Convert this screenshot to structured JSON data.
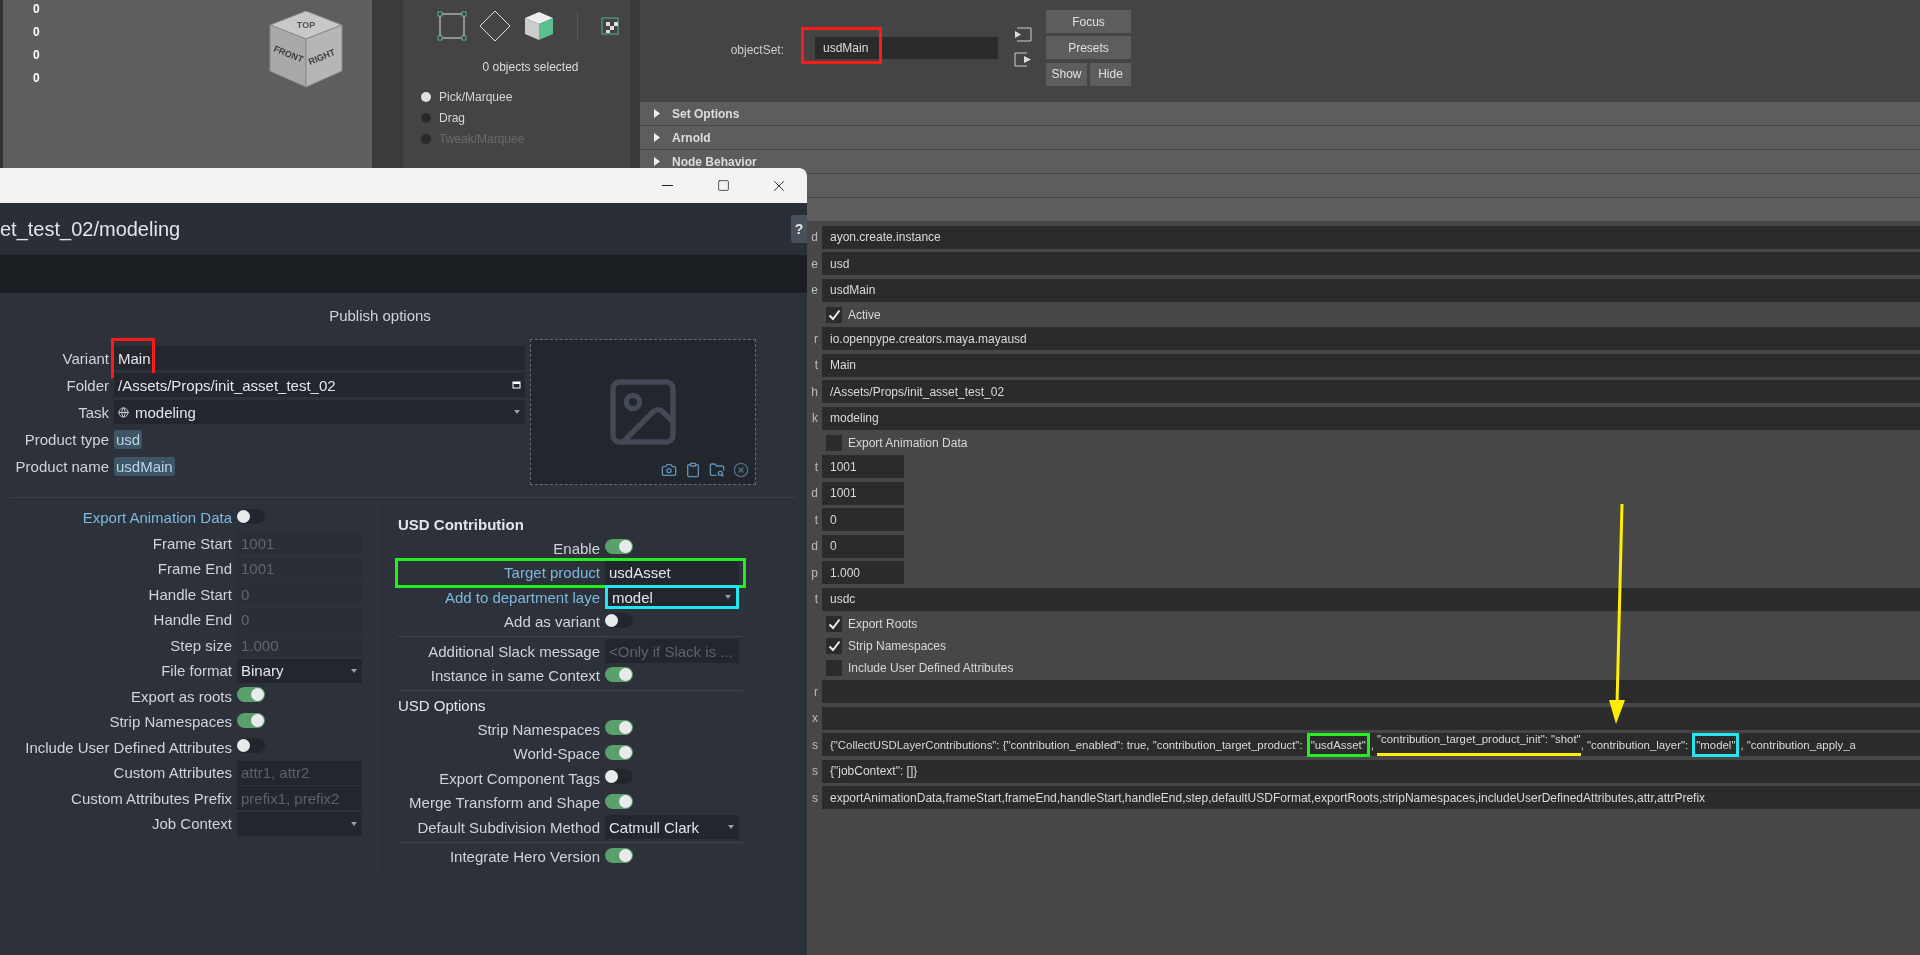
{
  "viewport": {
    "axis_values": [
      "0",
      "0",
      "0",
      "0"
    ],
    "view_cube": {
      "top": "TOP",
      "front": "FRONT",
      "right": "RIGHT"
    }
  },
  "tool_settings": {
    "selection_info": "0 objects selected",
    "modes": [
      {
        "label": "Pick/Marquee",
        "selected": true,
        "disabled": false
      },
      {
        "label": "Drag",
        "selected": false,
        "disabled": false
      },
      {
        "label": "Tweak/Marquee",
        "selected": false,
        "disabled": true
      }
    ]
  },
  "attribute_editor": {
    "object_set": {
      "label": "objectSet:",
      "value": "usdMain",
      "color": "#ff1a1a"
    },
    "buttons": [
      "Focus",
      "Presets",
      "Show",
      "Hide"
    ],
    "sections": [
      {
        "label": "Set Options"
      },
      {
        "label": "Arnold"
      },
      {
        "label": "Node Behavior"
      }
    ],
    "arrow": {
      "color": "#ffee00"
    },
    "rows": [
      {
        "kind": "text",
        "label_tail": "d",
        "value": "ayon.create.instance"
      },
      {
        "kind": "text",
        "label_tail": "e",
        "value": "usd"
      },
      {
        "kind": "text",
        "label_tail": "e",
        "value": "usdMain"
      },
      {
        "kind": "checkbox",
        "label": "Active",
        "checked": true
      },
      {
        "kind": "text",
        "label_tail": "r",
        "value": "io.openpype.creators.maya.mayausd"
      },
      {
        "kind": "text",
        "label_tail": "t",
        "value": "Main"
      },
      {
        "kind": "text",
        "label_tail": "h",
        "value": "/Assets/Props/init_asset_test_02"
      },
      {
        "kind": "text",
        "label_tail": "k",
        "value": "modeling"
      },
      {
        "kind": "checkbox",
        "label": "Export Animation Data",
        "checked": false
      },
      {
        "kind": "short",
        "label_tail": "t",
        "value": "1001"
      },
      {
        "kind": "short",
        "label_tail": "d",
        "value": "1001"
      },
      {
        "kind": "short",
        "label_tail": "t",
        "value": "0"
      },
      {
        "kind": "short",
        "label_tail": "d",
        "value": "0"
      },
      {
        "kind": "short",
        "label_tail": "p",
        "value": "1.000"
      },
      {
        "kind": "text",
        "label_tail": "t",
        "value": "usdc"
      },
      {
        "kind": "checkbox",
        "label": "Export Roots",
        "checked": true
      },
      {
        "kind": "checkbox",
        "label": "Strip Namespaces",
        "checked": true
      },
      {
        "kind": "checkbox",
        "label": "Include User Defined Attributes",
        "checked": false
      },
      {
        "kind": "text",
        "label_tail": "r"
      },
      {
        "kind": "text",
        "label_tail": "x"
      },
      {
        "kind": "segments",
        "label_tail": "s",
        "segments": [
          {
            "text": "{\"CollectUSDLayerContributions\": {\"contribution_enabled\": true, \"contribution_target_product\": "
          },
          {
            "text": "\"usdAsset\"",
            "kind": "box",
            "color": "#22ee22"
          },
          {
            "text": ", "
          },
          {
            "text": "\"contribution_target_product_init\": \"shot\"",
            "kind": "underline",
            "color": "#ffee00"
          },
          {
            "text": ", \"contribution_layer\": "
          },
          {
            "text": "\"model\"",
            "kind": "box",
            "color": "#22e5f0"
          },
          {
            "text": ", \"contribution_apply_a"
          }
        ]
      },
      {
        "kind": "text",
        "label_tail": "s",
        "value": "{\"jobContext\": []}"
      },
      {
        "kind": "text",
        "label_tail": "s",
        "value": "exportAnimationData,frameStart,frameEnd,handleStart,handleEnd,step,defaultUSDFormat,exportRoots,stripNamespaces,includeUserDefinedAttributes,attr,attrPrefix"
      }
    ]
  },
  "dialog": {
    "title": "et_test_02/modeling",
    "help": "?",
    "section_title": "Publish options",
    "fields": [
      {
        "kind": "text",
        "label": "Variant",
        "value": "Main",
        "color": "#ff1a1a"
      },
      {
        "kind": "folder",
        "label": "Folder",
        "value": "/Assets/Props/init_asset_test_02"
      },
      {
        "kind": "task",
        "label": "Task",
        "value": "modeling"
      },
      {
        "kind": "chip",
        "label": "Product type",
        "value": "usd"
      },
      {
        "kind": "chip",
        "label": "Product name",
        "value": "usdMain"
      }
    ],
    "left_options": [
      {
        "kind": "toggle",
        "label": "Export Animation Data",
        "on": false,
        "accent": true
      },
      {
        "kind": "field",
        "label": "Frame Start",
        "value": "1001",
        "disabled": true
      },
      {
        "kind": "field",
        "label": "Frame End",
        "value": "1001",
        "disabled": true
      },
      {
        "kind": "field",
        "label": "Handle Start",
        "value": "0",
        "disabled": true
      },
      {
        "kind": "field",
        "label": "Handle End",
        "value": "0",
        "disabled": true
      },
      {
        "kind": "field",
        "label": "Step size",
        "value": "1.000",
        "disabled": true
      },
      {
        "kind": "dropdown",
        "label": "File format",
        "value": "Binary"
      },
      {
        "kind": "toggle",
        "label": "Export as roots",
        "on": true
      },
      {
        "kind": "toggle",
        "label": "Strip Namespaces",
        "on": true
      },
      {
        "kind": "toggle",
        "label": "Include User Defined Attributes",
        "on": false
      },
      {
        "kind": "field",
        "label": "Custom Attributes",
        "placeholder": "attr1, attr2"
      },
      {
        "kind": "field",
        "label": "Custom Attributes Prefix",
        "placeholder": "prefix1, prefix2"
      },
      {
        "kind": "dropdown",
        "label": "Job Context"
      }
    ],
    "right_options": [
      {
        "kind": "heading",
        "label": "USD Contribution"
      },
      {
        "kind": "toggle",
        "label": "Enable",
        "on": true
      },
      {
        "kind": "field",
        "label": "Target product",
        "value": "usdAsset",
        "accent": true,
        "color": "#22ee22"
      },
      {
        "kind": "dropdown",
        "label": "Add to department laye",
        "value": "model",
        "accent": true,
        "color": "#22e5f0"
      },
      {
        "kind": "toggle",
        "label": "Add as variant",
        "on": false
      },
      {
        "kind": "divider"
      },
      {
        "kind": "field",
        "label": "Additional Slack message",
        "placeholder": "<Only if Slack is ..."
      },
      {
        "kind": "toggle",
        "label": "Instance in same Context",
        "on": true
      },
      {
        "kind": "divider"
      },
      {
        "kind": "subheading",
        "label": "USD Options"
      },
      {
        "kind": "toggle",
        "label": "Strip Namespaces",
        "on": true
      },
      {
        "kind": "toggle",
        "label": "World-Space",
        "on": true
      },
      {
        "kind": "toggle",
        "label": "Export Component Tags",
        "on": false
      },
      {
        "kind": "toggle",
        "label": "Merge Transform and Shape",
        "on": true
      },
      {
        "kind": "dropdown",
        "label": "Default Subdivision Method",
        "value": "Catmull Clark"
      },
      {
        "kind": "divider"
      },
      {
        "kind": "toggle",
        "label": "Integrate Hero Version",
        "on": true
      }
    ]
  }
}
